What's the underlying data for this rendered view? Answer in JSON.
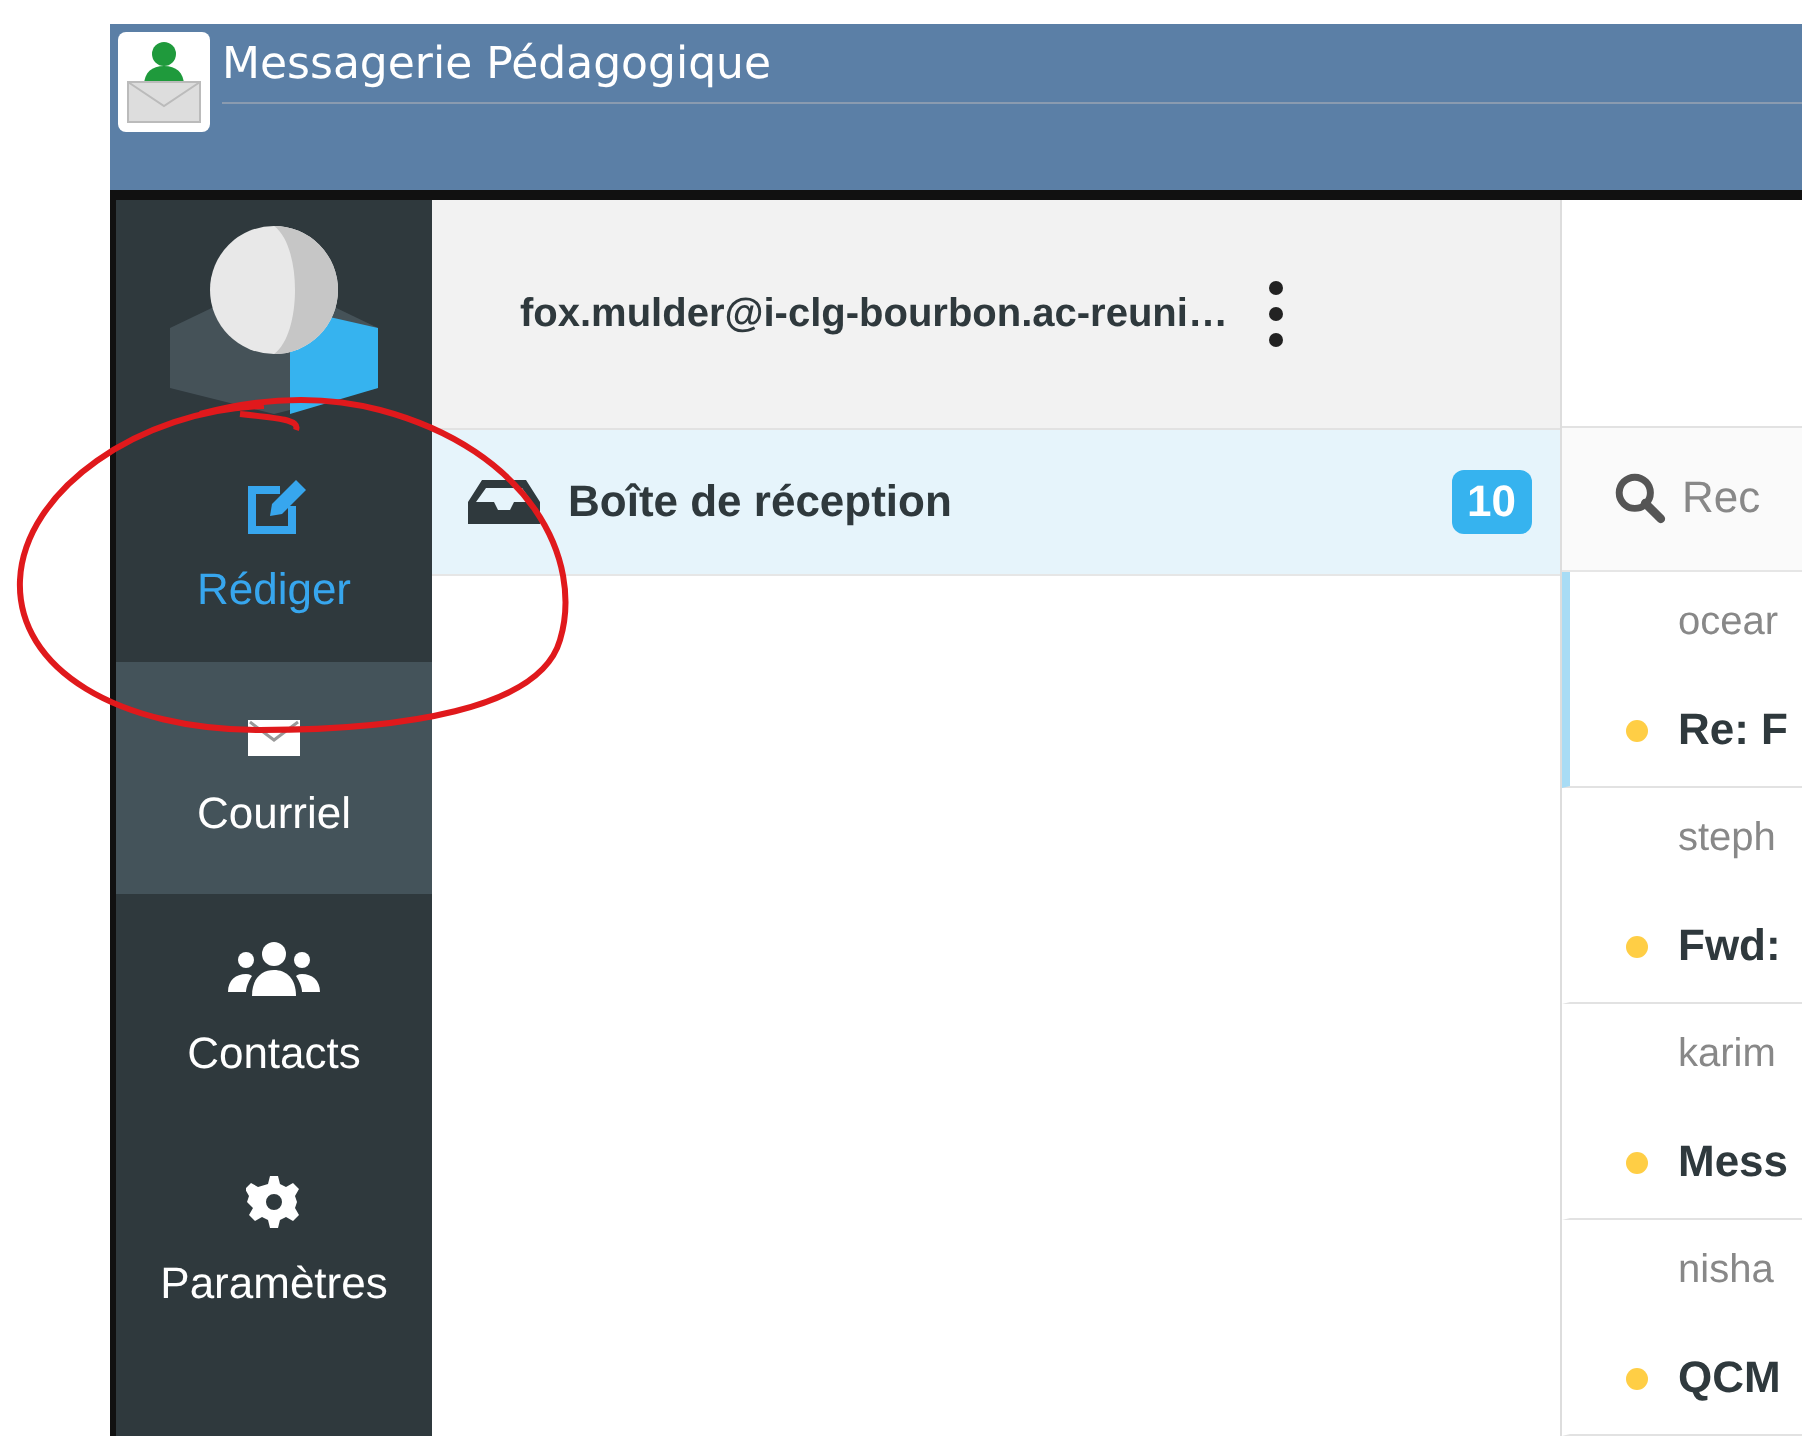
{
  "window": {
    "title": "Messagerie Pédagogique"
  },
  "sidebar": {
    "items": [
      {
        "label": "Rédiger",
        "kind": "compose",
        "selected": false
      },
      {
        "label": "Courriel",
        "kind": "mail",
        "selected": true
      },
      {
        "label": "Contacts",
        "kind": "contacts",
        "selected": false
      },
      {
        "label": "Paramètres",
        "kind": "settings",
        "selected": false
      }
    ]
  },
  "account": {
    "email": "fox.mulder@i-clg-bourbon.ac-reuni…"
  },
  "folders": [
    {
      "name": "Boîte de réception",
      "unread_count": "10",
      "selected": true
    }
  ],
  "search": {
    "placeholder": "Rec"
  },
  "messages": [
    {
      "sender": "ocear",
      "subject": "Re: F",
      "unread": true,
      "selected": true
    },
    {
      "sender": "steph",
      "subject": "Fwd:",
      "unread": true,
      "selected": false
    },
    {
      "sender": "karim",
      "subject": "Mess",
      "unread": true,
      "selected": false
    },
    {
      "sender": "nisha",
      "subject": "QCM",
      "unread": true,
      "selected": false
    }
  ]
}
